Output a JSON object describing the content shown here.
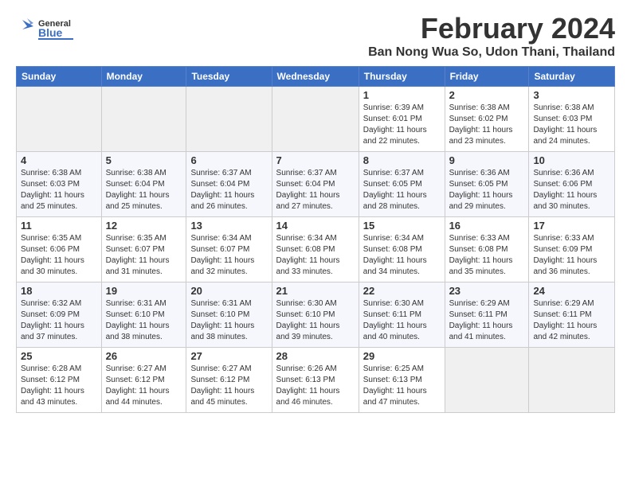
{
  "header": {
    "logo_general": "General",
    "logo_blue": "Blue",
    "month_title": "February 2024",
    "location": "Ban Nong Wua So, Udon Thani, Thailand"
  },
  "weekdays": [
    "Sunday",
    "Monday",
    "Tuesday",
    "Wednesday",
    "Thursday",
    "Friday",
    "Saturday"
  ],
  "weeks": [
    [
      {
        "day": "",
        "info": ""
      },
      {
        "day": "",
        "info": ""
      },
      {
        "day": "",
        "info": ""
      },
      {
        "day": "",
        "info": ""
      },
      {
        "day": "1",
        "info": "Sunrise: 6:39 AM\nSunset: 6:01 PM\nDaylight: 11 hours\nand 22 minutes."
      },
      {
        "day": "2",
        "info": "Sunrise: 6:38 AM\nSunset: 6:02 PM\nDaylight: 11 hours\nand 23 minutes."
      },
      {
        "day": "3",
        "info": "Sunrise: 6:38 AM\nSunset: 6:03 PM\nDaylight: 11 hours\nand 24 minutes."
      }
    ],
    [
      {
        "day": "4",
        "info": "Sunrise: 6:38 AM\nSunset: 6:03 PM\nDaylight: 11 hours\nand 25 minutes."
      },
      {
        "day": "5",
        "info": "Sunrise: 6:38 AM\nSunset: 6:04 PM\nDaylight: 11 hours\nand 25 minutes."
      },
      {
        "day": "6",
        "info": "Sunrise: 6:37 AM\nSunset: 6:04 PM\nDaylight: 11 hours\nand 26 minutes."
      },
      {
        "day": "7",
        "info": "Sunrise: 6:37 AM\nSunset: 6:04 PM\nDaylight: 11 hours\nand 27 minutes."
      },
      {
        "day": "8",
        "info": "Sunrise: 6:37 AM\nSunset: 6:05 PM\nDaylight: 11 hours\nand 28 minutes."
      },
      {
        "day": "9",
        "info": "Sunrise: 6:36 AM\nSunset: 6:05 PM\nDaylight: 11 hours\nand 29 minutes."
      },
      {
        "day": "10",
        "info": "Sunrise: 6:36 AM\nSunset: 6:06 PM\nDaylight: 11 hours\nand 30 minutes."
      }
    ],
    [
      {
        "day": "11",
        "info": "Sunrise: 6:35 AM\nSunset: 6:06 PM\nDaylight: 11 hours\nand 30 minutes."
      },
      {
        "day": "12",
        "info": "Sunrise: 6:35 AM\nSunset: 6:07 PM\nDaylight: 11 hours\nand 31 minutes."
      },
      {
        "day": "13",
        "info": "Sunrise: 6:34 AM\nSunset: 6:07 PM\nDaylight: 11 hours\nand 32 minutes."
      },
      {
        "day": "14",
        "info": "Sunrise: 6:34 AM\nSunset: 6:08 PM\nDaylight: 11 hours\nand 33 minutes."
      },
      {
        "day": "15",
        "info": "Sunrise: 6:34 AM\nSunset: 6:08 PM\nDaylight: 11 hours\nand 34 minutes."
      },
      {
        "day": "16",
        "info": "Sunrise: 6:33 AM\nSunset: 6:08 PM\nDaylight: 11 hours\nand 35 minutes."
      },
      {
        "day": "17",
        "info": "Sunrise: 6:33 AM\nSunset: 6:09 PM\nDaylight: 11 hours\nand 36 minutes."
      }
    ],
    [
      {
        "day": "18",
        "info": "Sunrise: 6:32 AM\nSunset: 6:09 PM\nDaylight: 11 hours\nand 37 minutes."
      },
      {
        "day": "19",
        "info": "Sunrise: 6:31 AM\nSunset: 6:10 PM\nDaylight: 11 hours\nand 38 minutes."
      },
      {
        "day": "20",
        "info": "Sunrise: 6:31 AM\nSunset: 6:10 PM\nDaylight: 11 hours\nand 38 minutes."
      },
      {
        "day": "21",
        "info": "Sunrise: 6:30 AM\nSunset: 6:10 PM\nDaylight: 11 hours\nand 39 minutes."
      },
      {
        "day": "22",
        "info": "Sunrise: 6:30 AM\nSunset: 6:11 PM\nDaylight: 11 hours\nand 40 minutes."
      },
      {
        "day": "23",
        "info": "Sunrise: 6:29 AM\nSunset: 6:11 PM\nDaylight: 11 hours\nand 41 minutes."
      },
      {
        "day": "24",
        "info": "Sunrise: 6:29 AM\nSunset: 6:11 PM\nDaylight: 11 hours\nand 42 minutes."
      }
    ],
    [
      {
        "day": "25",
        "info": "Sunrise: 6:28 AM\nSunset: 6:12 PM\nDaylight: 11 hours\nand 43 minutes."
      },
      {
        "day": "26",
        "info": "Sunrise: 6:27 AM\nSunset: 6:12 PM\nDaylight: 11 hours\nand 44 minutes."
      },
      {
        "day": "27",
        "info": "Sunrise: 6:27 AM\nSunset: 6:12 PM\nDaylight: 11 hours\nand 45 minutes."
      },
      {
        "day": "28",
        "info": "Sunrise: 6:26 AM\nSunset: 6:13 PM\nDaylight: 11 hours\nand 46 minutes."
      },
      {
        "day": "29",
        "info": "Sunrise: 6:25 AM\nSunset: 6:13 PM\nDaylight: 11 hours\nand 47 minutes."
      },
      {
        "day": "",
        "info": ""
      },
      {
        "day": "",
        "info": ""
      }
    ]
  ]
}
